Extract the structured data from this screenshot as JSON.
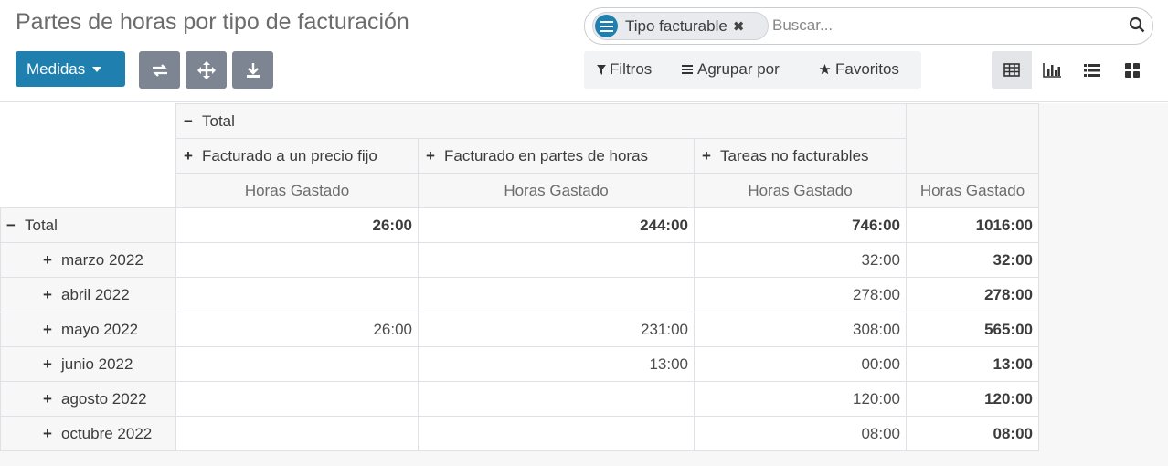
{
  "page": {
    "title": "Partes de horas por tipo de facturación"
  },
  "toolbar": {
    "measures_label": "Medidas"
  },
  "search": {
    "facet_label": "Tipo facturable",
    "facet_close": "✖",
    "placeholder": "Buscar..."
  },
  "filters": {
    "filters_label": "Filtros",
    "groupby_label": "Agrupar por",
    "favorites_label": "Favoritos"
  },
  "colors": {
    "primary": "#1f7fae",
    "tool_button": "#7d8492"
  },
  "pivot": {
    "col_total_label": "Total",
    "col_groups": [
      "Facturado a un precio fijo",
      "Facturado en partes de horas",
      "Tareas no facturables"
    ],
    "measure_label": "Horas Gastado",
    "row_total_label": "Total",
    "total_row": [
      "26:00",
      "244:00",
      "746:00",
      "1016:00"
    ],
    "rows": [
      {
        "label": "marzo 2022",
        "values": [
          "",
          "",
          "32:00",
          "32:00"
        ]
      },
      {
        "label": "abril 2022",
        "values": [
          "",
          "",
          "278:00",
          "278:00"
        ]
      },
      {
        "label": "mayo 2022",
        "values": [
          "26:00",
          "231:00",
          "308:00",
          "565:00"
        ]
      },
      {
        "label": "junio 2022",
        "values": [
          "",
          "13:00",
          "00:00",
          "13:00"
        ]
      },
      {
        "label": "agosto 2022",
        "values": [
          "",
          "",
          "120:00",
          "120:00"
        ]
      },
      {
        "label": "octubre 2022",
        "values": [
          "",
          "",
          "08:00",
          "08:00"
        ]
      }
    ]
  }
}
